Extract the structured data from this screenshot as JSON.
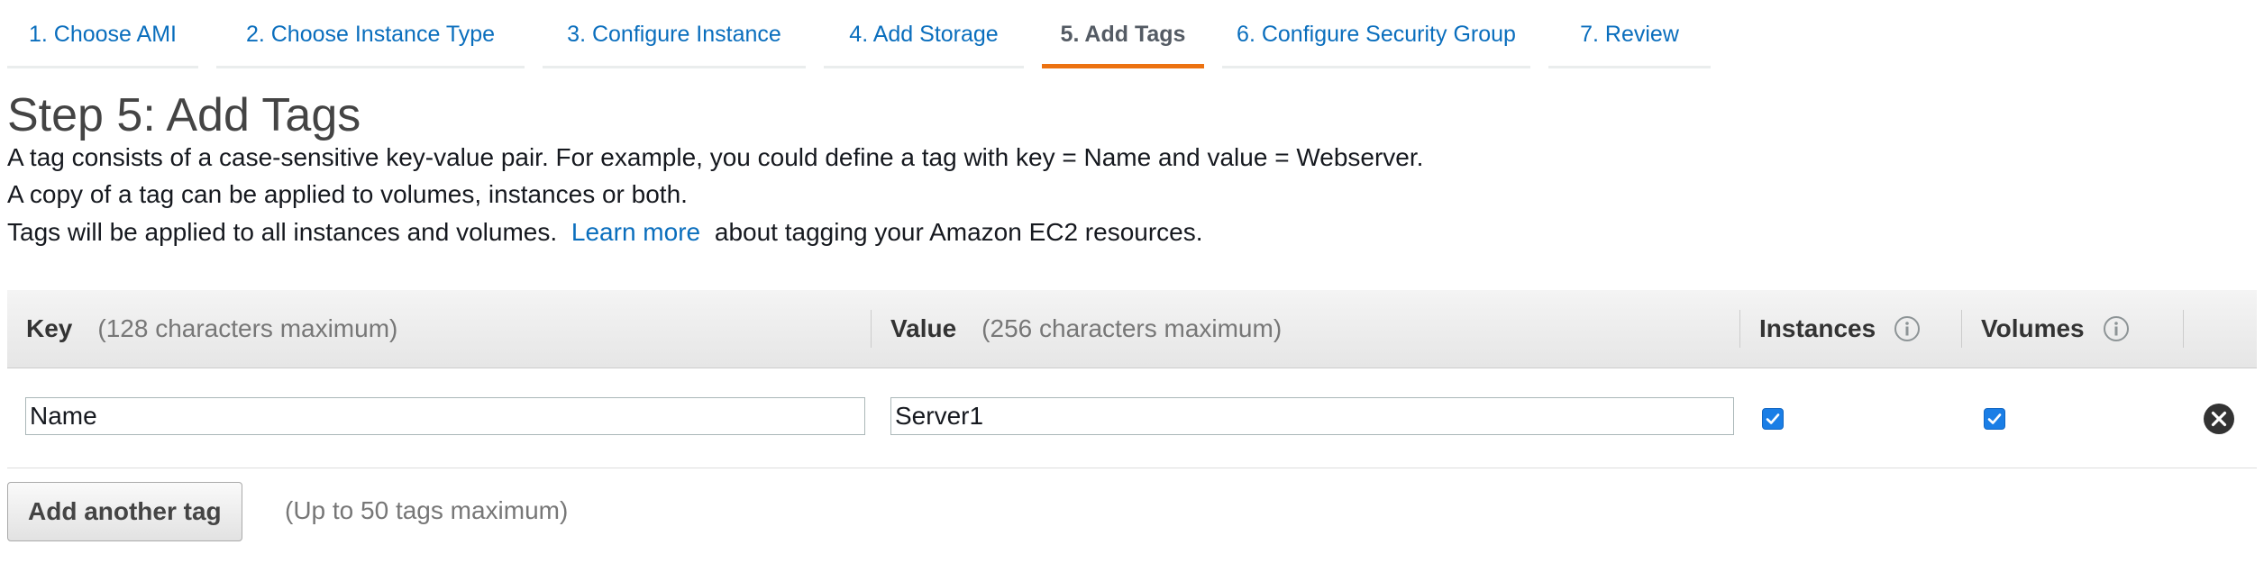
{
  "wizard": {
    "tabs": [
      {
        "label": "1. Choose AMI",
        "active": false
      },
      {
        "label": "2. Choose Instance Type",
        "active": false
      },
      {
        "label": "3. Configure Instance",
        "active": false
      },
      {
        "label": "4. Add Storage",
        "active": false
      },
      {
        "label": "5. Add Tags",
        "active": true
      },
      {
        "label": "6. Configure Security Group",
        "active": false
      },
      {
        "label": "7. Review",
        "active": false
      }
    ]
  },
  "page": {
    "title": "Step 5: Add Tags",
    "line1": "A tag consists of a case-sensitive key-value pair. For example, you could define a tag with key = Name and value = Webserver.",
    "line2": "A copy of a tag can be applied to volumes, instances or both.",
    "line3_before": "Tags will be applied to all instances and volumes.",
    "learn_more": "Learn more",
    "line3_after": "about tagging your Amazon EC2 resources."
  },
  "table": {
    "headers": {
      "key": "Key",
      "key_hint": "(128 characters maximum)",
      "value": "Value",
      "value_hint": "(256 characters maximum)",
      "instances": "Instances",
      "volumes": "Volumes"
    },
    "rows": [
      {
        "key": "Name",
        "value": "Server1",
        "instances": true,
        "volumes": true
      }
    ]
  },
  "actions": {
    "add_tag": "Add another tag",
    "add_tag_hint": "(Up to 50 tags maximum)"
  },
  "colors": {
    "link": "#0a6ebd",
    "active_tab_underline": "#ec7211",
    "checkbox": "#1a7ee6"
  },
  "icons": {
    "info": "info-icon",
    "remove": "remove-tag-icon",
    "checkbox": "checkmark-icon"
  }
}
